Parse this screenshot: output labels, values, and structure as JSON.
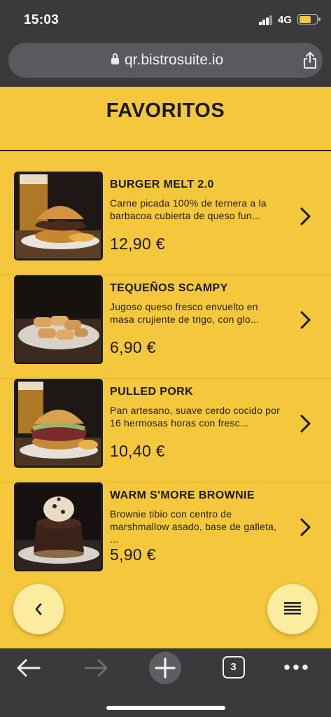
{
  "status_bar": {
    "time": "15:03",
    "network": "4G",
    "battery_level": 0.7
  },
  "browser": {
    "url": "qr.bistrosuite.io",
    "tab_count": "3"
  },
  "page": {
    "title": "FAVORITOS"
  },
  "menu_items": [
    {
      "name": "BURGER MELT 2.0",
      "description": "Carne picada 100% de ternera a la barbacoa cubierta de queso fun...",
      "price": "12,90 €",
      "image": "burger-photo"
    },
    {
      "name": "TEQUEÑOS SCAMPY",
      "description": "Jugoso queso fresco envuelto en masa crujiente de trigo, con glo...",
      "price": "6,90 €",
      "image": "tequenos-photo"
    },
    {
      "name": "PULLED PORK",
      "description": "Pan artesano, suave cerdo cocido por 16 hermosas horas con fresc...",
      "price": "10,40 €",
      "image": "pulled-pork-photo"
    },
    {
      "name": "WARM S'MORE BROWNIE",
      "description": "Brownie tibio con centro de marshmallow asado, base de galleta, ...",
      "price": "5,90 €",
      "image": "brownie-photo"
    }
  ],
  "colors": {
    "background_yellow": "#f5c73a",
    "fab_light_yellow": "#fbeca0",
    "browser_chrome": "#3a3a3c"
  },
  "icons": {
    "back_fab": "chevron-left-icon",
    "menu_fab": "hamburger-menu-icon",
    "item_arrow": "chevron-right-icon",
    "nav_back": "arrow-left-icon",
    "nav_forward": "arrow-right-icon",
    "new_tab": "plus-icon",
    "tabs": "tabs-icon",
    "more": "more-dots-icon"
  }
}
